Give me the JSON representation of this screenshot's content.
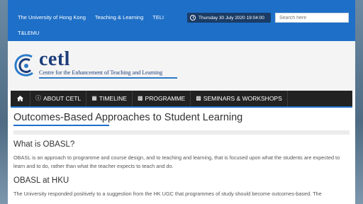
{
  "topbar": {
    "links": [
      "The University of Hong Kong",
      "Teaching & Learning",
      "TELI"
    ],
    "link_second_row": "T&LEMU",
    "date": "Thursday 30 July 2020 19:04:00",
    "search_placeholder": "Search here"
  },
  "header": {
    "logo_word": "cetl",
    "logo_subtitle": "Centre for the Enhancement of Teaching and Learning"
  },
  "nav": {
    "items": [
      "ABOUT CETL",
      "TIMELINE",
      "PROGRAMME",
      "SEMINARS & WORKSHOPS"
    ]
  },
  "content": {
    "title": "Outcomes-Based Approaches to Student Learning",
    "section1_heading": "What is OBASL?",
    "section1_text": "OBASL is an approach to programme and course design, and to teaching and learning, that is focused upon what the students are expected to learn and to do, rather than what the teacher expects to teach and do.",
    "section2_heading": "OBASL at HKU",
    "section2_text": "The University responded positively to a suggestion from the HK UGC that programmes of study should become outcomes-based. The"
  },
  "colors": {
    "topbar": "#1e6fc7",
    "nav": "#222222",
    "logo": "#1d3d7a"
  }
}
